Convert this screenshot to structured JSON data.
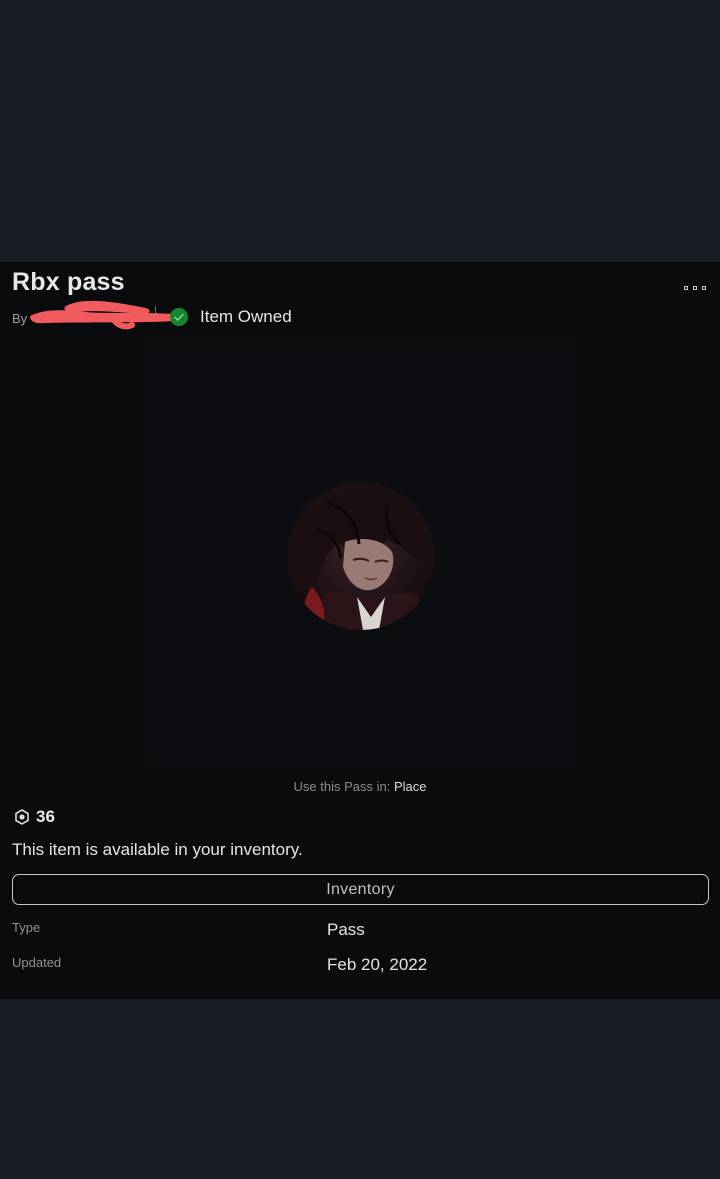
{
  "item": {
    "title": "Rbx pass",
    "by_label": "By",
    "creator_name": "",
    "owned_label": "Item Owned"
  },
  "usage": {
    "prefix": "Use this Pass in: ",
    "place_link": "Place"
  },
  "price": {
    "icon": "robux-icon",
    "value": "36"
  },
  "availability_text": "This item is available in your inventory.",
  "inventory_button_label": "Inventory",
  "details": [
    {
      "label": "Type",
      "value": "Pass"
    },
    {
      "label": "Updated",
      "value": "Feb 20, 2022"
    }
  ],
  "colors": {
    "background": "#181c24",
    "panel": "#0a0b0d",
    "owned_check": "#17852e",
    "redaction": "#f25b5e"
  }
}
